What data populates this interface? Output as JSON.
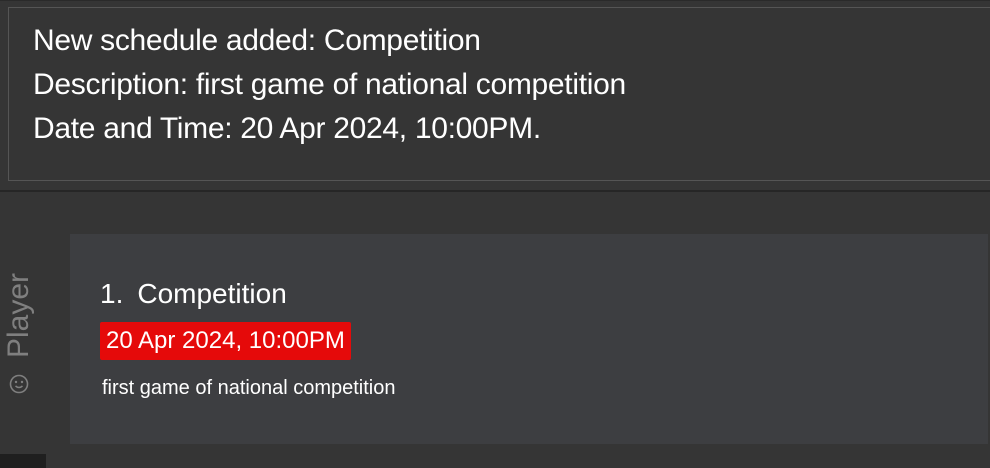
{
  "result": {
    "line1": "New schedule added: Competition",
    "line2": "Description: first game of national competition",
    "line3": "Date and Time: 20 Apr 2024, 10:00PM."
  },
  "side_tab": {
    "label": "Player",
    "icon": "smile-icon"
  },
  "schedule_list": {
    "items": [
      {
        "index": "1.",
        "name": "Competition",
        "datetime": "20 Apr 2024, 10:00PM",
        "description": "first game of national competition"
      }
    ]
  },
  "colors": {
    "background": "#353535",
    "card": "#3d3e41",
    "date_badge": "#e50a0a",
    "text": "#ffffff",
    "muted": "#7f7f7f"
  }
}
